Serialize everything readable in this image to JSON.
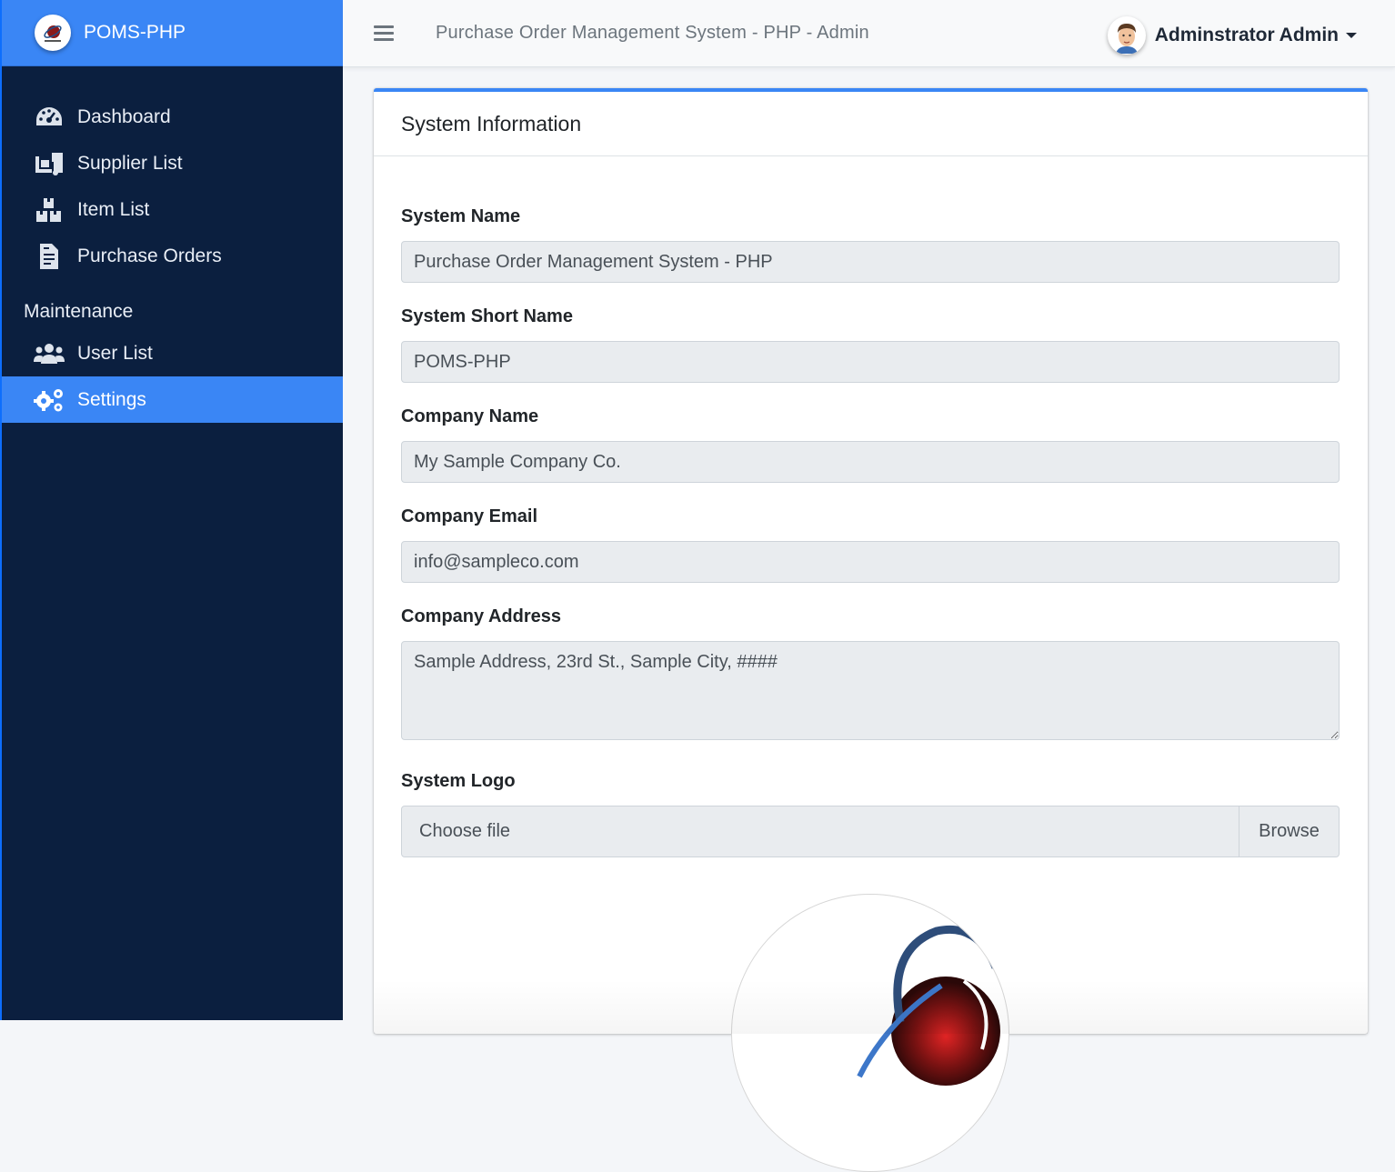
{
  "brand": {
    "name": "POMS-PHP",
    "logo_icon": "planet-logo-icon"
  },
  "sidebar": {
    "items": [
      {
        "label": "Dashboard",
        "icon": "tachometer-icon",
        "active": false
      },
      {
        "label": "Supplier List",
        "icon": "truck-loading-icon",
        "active": false
      },
      {
        "label": "Item List",
        "icon": "boxes-icon",
        "active": false
      },
      {
        "label": "Purchase Orders",
        "icon": "file-invoice-icon",
        "active": false
      }
    ],
    "section_header": "Maintenance",
    "maintenance_items": [
      {
        "label": "User List",
        "icon": "users-icon",
        "active": false
      },
      {
        "label": "Settings",
        "icon": "cogs-icon",
        "active": true
      }
    ]
  },
  "topbar": {
    "title": "Purchase Order Management System - PHP - Admin",
    "user_name": "Adminstrator Admin"
  },
  "card": {
    "title": "System Information",
    "fields": {
      "system_name": {
        "label": "System Name",
        "value": "Purchase Order Management System - PHP"
      },
      "short_name": {
        "label": "System Short Name",
        "value": "POMS-PHP"
      },
      "company_name": {
        "label": "Company Name",
        "value": "My Sample Company Co."
      },
      "company_email": {
        "label": "Company Email",
        "value": "info@sampleco.com"
      },
      "company_address": {
        "label": "Company Address",
        "value": "Sample Address, 23rd St., Sample City, ####"
      },
      "system_logo": {
        "label": "System Logo",
        "file_placeholder": "Choose file",
        "browse_label": "Browse"
      }
    }
  },
  "colors": {
    "sidebar_bg": "#0b1f3f",
    "accent": "#3a86f5",
    "input_bg": "#e9ecef"
  }
}
